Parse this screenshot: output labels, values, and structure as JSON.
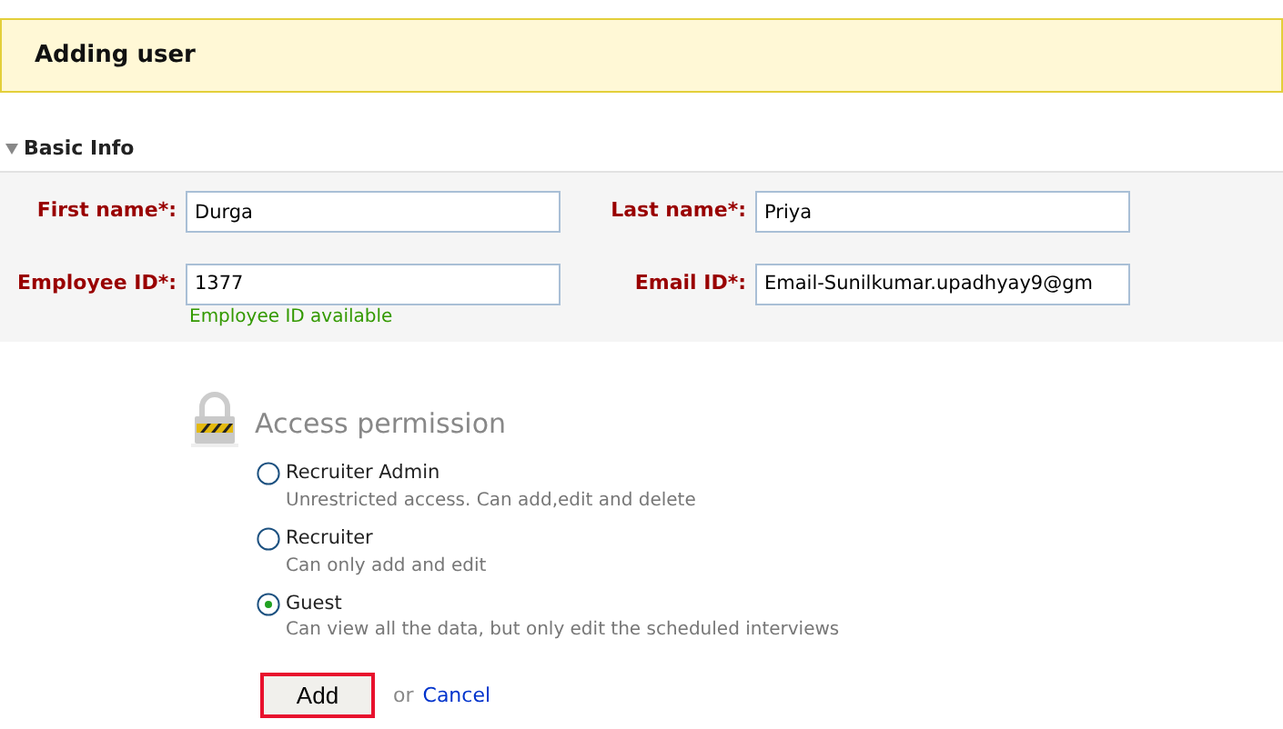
{
  "header": {
    "title": "Adding user"
  },
  "section": {
    "title": "Basic Info",
    "expanded": true
  },
  "fields": [
    {
      "label": "First name*:",
      "value": "Durga"
    },
    {
      "label": "Last name*:",
      "value": "Priya"
    },
    {
      "label": "Employee ID*:",
      "value": "1377",
      "hint": "Employee ID available"
    },
    {
      "label": "Email ID*:",
      "value": "Email-Sunilkumar.upadhyay9@gm"
    }
  ],
  "access": {
    "title": "Access permission",
    "options": [
      {
        "label": "Recruiter Admin",
        "description": "Unrestricted access. Can add,edit and delete",
        "selected": false
      },
      {
        "label": "Recruiter",
        "description": "Can only add and edit",
        "selected": false
      },
      {
        "label": "Guest",
        "description": "Can view all the data, but only edit the scheduled interviews",
        "selected": true
      }
    ]
  },
  "actions": {
    "primary": "Add",
    "separator": "or",
    "cancel": "Cancel"
  }
}
